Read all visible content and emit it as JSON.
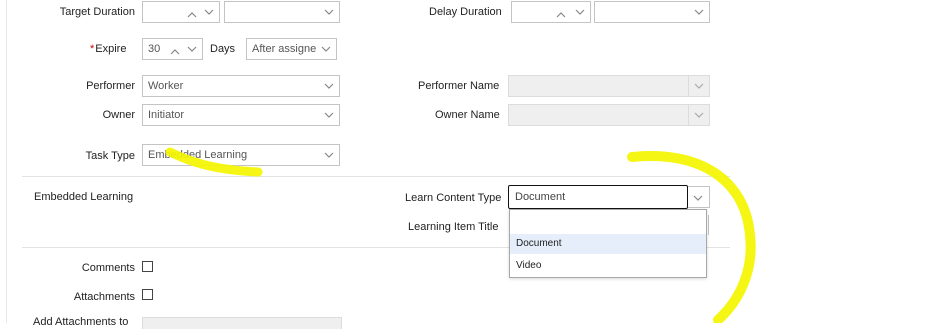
{
  "form": {
    "target_duration": {
      "label": "Target Duration",
      "value": "",
      "unit": ""
    },
    "delay_duration": {
      "label": "Delay Duration",
      "value": "",
      "unit": ""
    },
    "expire": {
      "required_mark": "*",
      "label": "Expire",
      "value": "30",
      "unit_label": "Days",
      "mode": "After assigne"
    },
    "performer": {
      "label": "Performer",
      "value": "Worker"
    },
    "performer_name": {
      "label": "Performer Name",
      "value": ""
    },
    "owner": {
      "label": "Owner",
      "value": "Initiator"
    },
    "owner_name": {
      "label": "Owner Name",
      "value": ""
    },
    "task_type": {
      "label": "Task Type",
      "value": "Embedded Learning"
    }
  },
  "embedded_section": {
    "title": "Embedded Learning",
    "learn_content_type": {
      "label": "Learn Content Type",
      "value": "Document"
    },
    "learning_item_title": {
      "label": "Learning Item Title"
    }
  },
  "dropdown": {
    "options": [
      "Document",
      "Video"
    ],
    "highlighted": "Document"
  },
  "bottom": {
    "comments_label": "Comments",
    "attachments_label": "Attachments",
    "add_attachments_label": "Add Attachments to"
  },
  "colors": {
    "annotation": "#f5f500",
    "highlight": "#e5eefa",
    "border": "#c4c4c4",
    "disabled_bg": "#efefef"
  }
}
